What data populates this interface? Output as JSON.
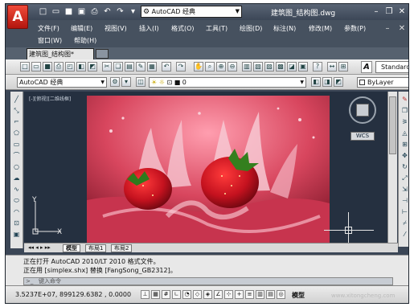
{
  "app": {
    "logo_letter": "A",
    "workspace": "AutoCAD 经典",
    "doc_title": "建筑图_结构图.dwg",
    "brand_color": "#d6281b"
  },
  "menu": [
    "文件(F)",
    "编辑(E)",
    "视图(V)",
    "插入(I)",
    "格式(O)",
    "工具(T)",
    "绘图(D)",
    "标注(N)",
    "修改(M)",
    "参数(P)",
    "窗口(W)",
    "帮助(H)"
  ],
  "doc_tab": {
    "label": "建筑图_结构图*"
  },
  "toolbar2": {
    "workspace": "AutoCAD 经典",
    "layer": "0",
    "color": "ByLayer"
  },
  "text_style": "Standard",
  "viewport_label": "[-][俯视][二维线框]",
  "viewcube": {
    "label": "WCS"
  },
  "ucs": {
    "x": "X",
    "y": "Y"
  },
  "layout_tabs": [
    "模型",
    "布局1",
    "布局2"
  ],
  "commands": {
    "line1": "正在打开 AutoCAD 2010/LT 2010 格式文件。",
    "line2": "正在用 [simplex.shx] 替换 [FangSong_GB2312]。",
    "input_placeholder": "键入命令"
  },
  "status": {
    "coords": "3.5237E+07, 899129.6382 , 0.0000",
    "model": "模型",
    "watermark": "www.xitongcheng.com"
  }
}
